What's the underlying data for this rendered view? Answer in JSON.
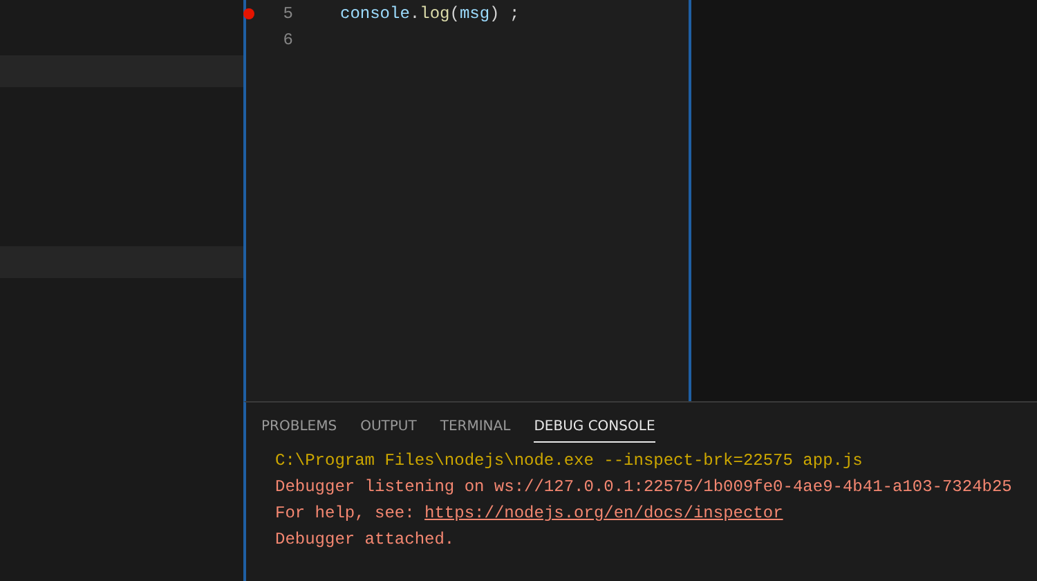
{
  "editor": {
    "lines": [
      {
        "number": "5",
        "breakpoint": true,
        "tokens": [
          {
            "text": "console",
            "kind": "variable"
          },
          {
            "text": ".",
            "kind": "plain"
          },
          {
            "text": "log",
            "kind": "function"
          },
          {
            "text": "(",
            "kind": "plain"
          },
          {
            "text": "msg",
            "kind": "variable"
          },
          {
            "text": ") ;",
            "kind": "plain"
          }
        ]
      },
      {
        "number": "6",
        "breakpoint": false
      }
    ]
  },
  "panel": {
    "tabs": [
      {
        "label": "PROBLEMS",
        "selected": false
      },
      {
        "label": "OUTPUT",
        "selected": false
      },
      {
        "label": "TERMINAL",
        "selected": false
      },
      {
        "label": "DEBUG CONSOLE",
        "selected": true
      }
    ],
    "console_lines": [
      {
        "kind": "command",
        "parts": [
          {
            "text": "C:\\Program Files\\nodejs\\node.exe --inspect-brk=22575 app.js",
            "kind": "text"
          }
        ]
      },
      {
        "kind": "error",
        "parts": [
          {
            "text": "Debugger listening on ws://127.0.0.1:22575/1b009fe0-4ae9-4b41-a103-7324b25",
            "kind": "text"
          }
        ]
      },
      {
        "kind": "error",
        "parts": [
          {
            "text": "For help, see: ",
            "kind": "text"
          },
          {
            "text": "https://nodejs.org/en/docs/inspector",
            "kind": "link"
          }
        ]
      },
      {
        "kind": "error",
        "parts": [
          {
            "text": "Debugger attached.",
            "kind": "text"
          }
        ]
      }
    ]
  }
}
